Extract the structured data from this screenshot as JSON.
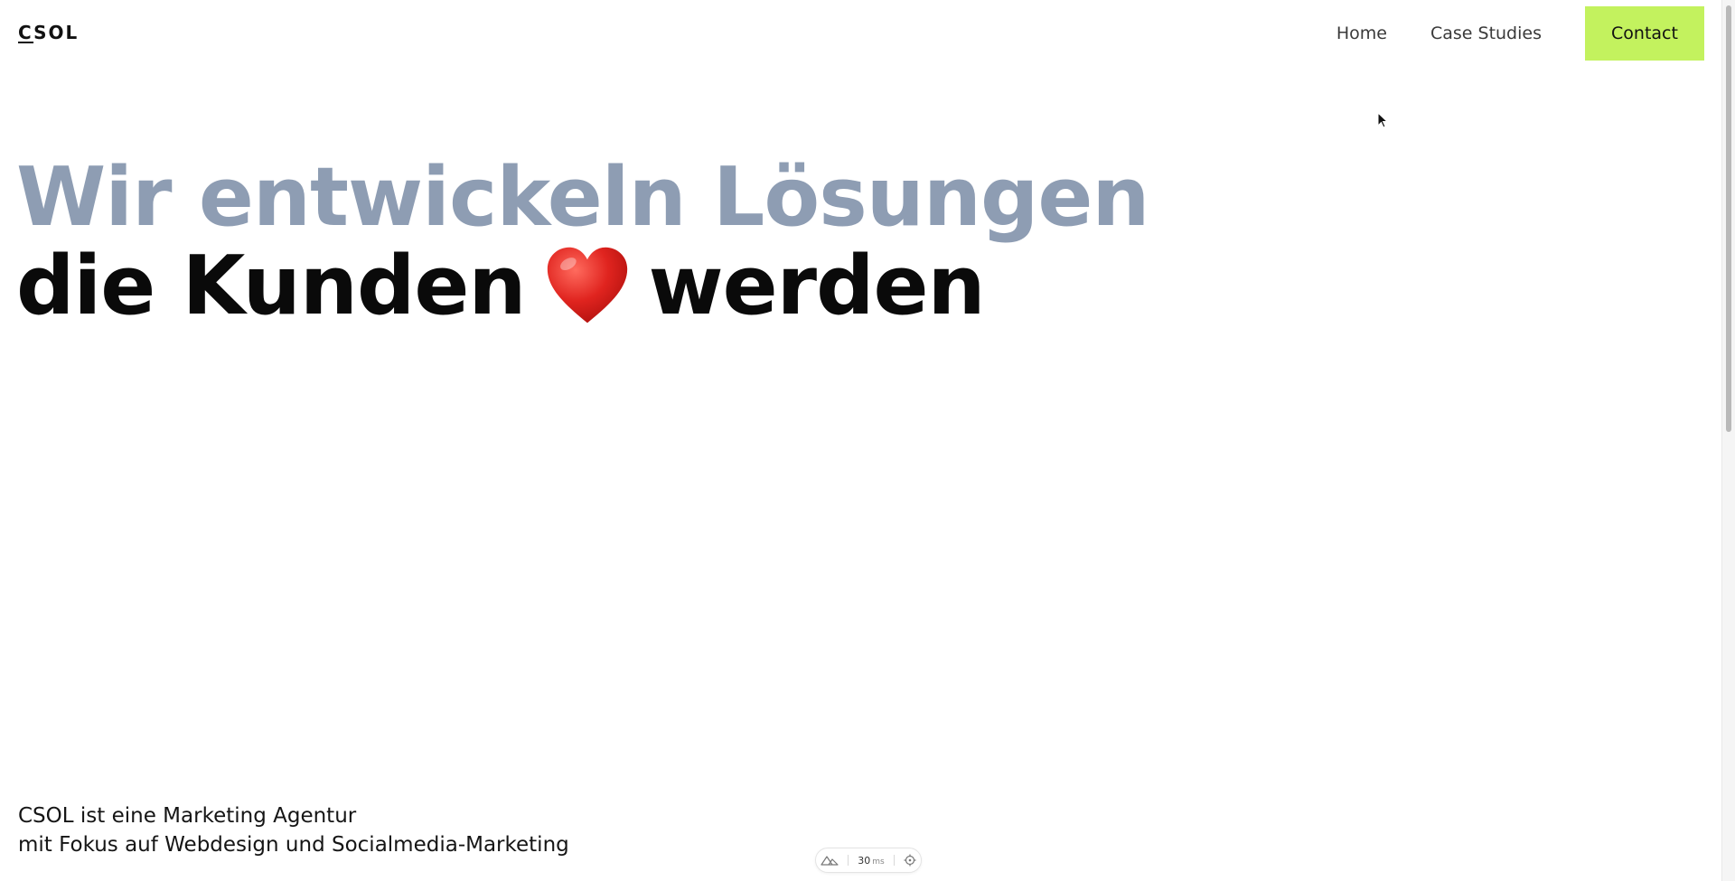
{
  "header": {
    "logo_first": "C",
    "logo_rest": "SOL",
    "nav": {
      "home": "Home",
      "case_studies": "Case Studies",
      "contact": "Contact"
    }
  },
  "hero": {
    "line1": "Wir entwickeln Lösungen",
    "line2_before": "die Kunden",
    "line2_icon": "heart-icon",
    "line2_after": "werden"
  },
  "intro": {
    "line1": "CSOL ist eine Marketing Agentur",
    "line2": "mit Fokus auf Webdesign und Socialmedia-Marketing"
  },
  "devbar": {
    "icon_left": "nuxt-icon",
    "timing_value": "30",
    "timing_unit": "ms",
    "icon_right": "target-icon"
  },
  "colors": {
    "accent": "#c3f25e",
    "hero_muted": "#8e9db3",
    "heart": "#e0241f"
  }
}
